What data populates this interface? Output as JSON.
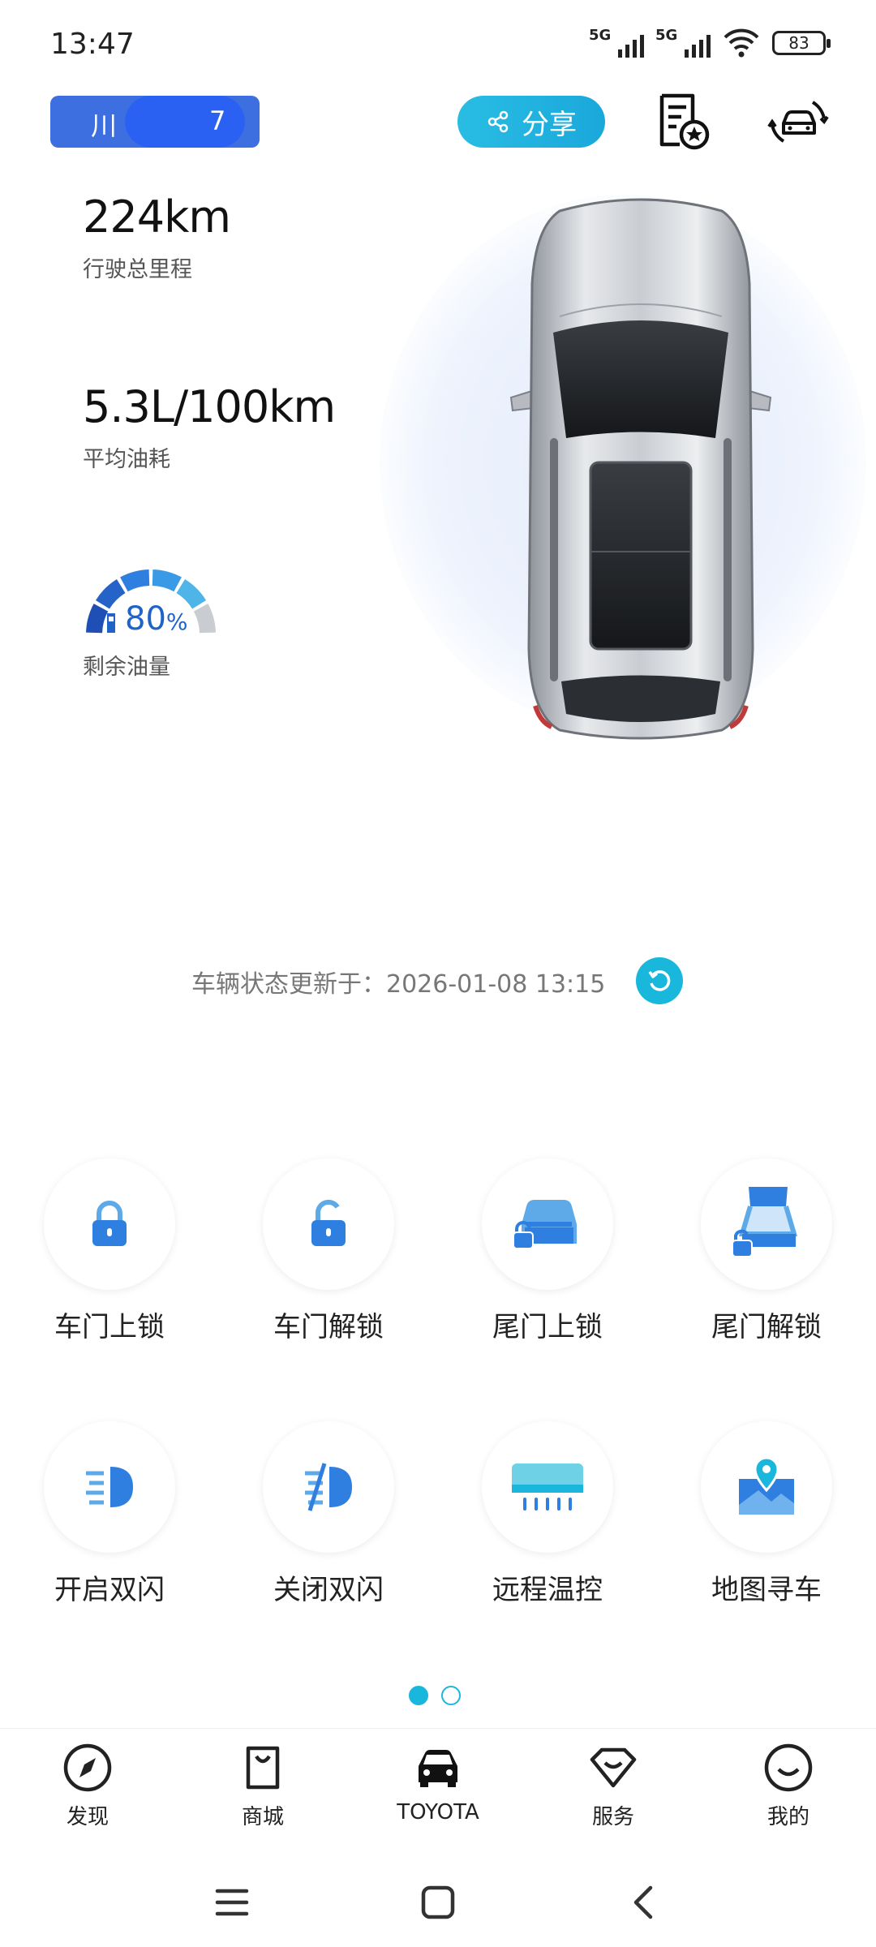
{
  "status_bar": {
    "time": "13:47",
    "sim1_label": "5G",
    "sim2_label": "5G",
    "battery": "83"
  },
  "header": {
    "plate_prefix": "川",
    "plate_suffix": "7",
    "share_label": "分享"
  },
  "stats": {
    "mileage_value": "224km",
    "mileage_label": "行驶总里程",
    "fuel_consumption_value": "5.3L/100km",
    "fuel_consumption_label": "平均油耗",
    "fuel_level_value": "80",
    "fuel_level_unit": "%",
    "fuel_level_fraction": 0.8,
    "fuel_level_label": "剩余油量"
  },
  "update": {
    "text": "车辆状态更新于：2026-01-08 13:15"
  },
  "controls": [
    {
      "label": "车门上锁",
      "icon": "lock-icon"
    },
    {
      "label": "车门解锁",
      "icon": "unlock-icon"
    },
    {
      "label": "尾门上锁",
      "icon": "trunk-lock-icon"
    },
    {
      "label": "尾门解锁",
      "icon": "trunk-unlock-icon"
    },
    {
      "label": "开启双闪",
      "icon": "hazard-on-icon"
    },
    {
      "label": "关闭双闪",
      "icon": "hazard-off-icon"
    },
    {
      "label": "远程温控",
      "icon": "air-conditioner-icon"
    },
    {
      "label": "地图寻车",
      "icon": "map-pin-icon"
    }
  ],
  "pager": {
    "pages": 2,
    "active": 1
  },
  "bottom_nav": [
    {
      "label": "发现",
      "icon": "compass-icon"
    },
    {
      "label": "商城",
      "icon": "shopping-bag-icon"
    },
    {
      "label": "TOYOTA",
      "icon": "car-icon",
      "active": true
    },
    {
      "label": "服务",
      "icon": "diamond-icon"
    },
    {
      "label": "我的",
      "icon": "smile-icon"
    }
  ],
  "colors": {
    "accent": "#19b7dc",
    "plate": "#3d6fe0",
    "icon_blue": "#2f7fe0"
  }
}
